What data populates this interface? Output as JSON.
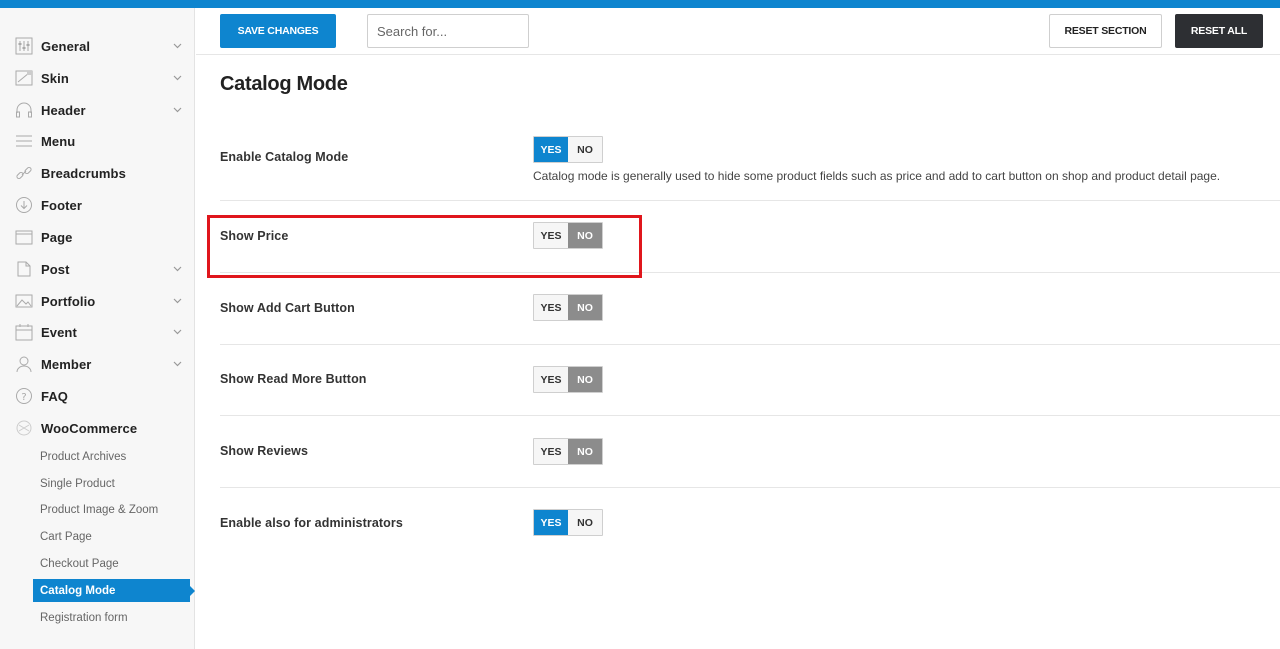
{
  "sidebar": {
    "items": [
      {
        "label": "General",
        "icon": "sliders-icon",
        "chevron": true
      },
      {
        "label": "Skin",
        "icon": "skin-icon",
        "chevron": true
      },
      {
        "label": "Header",
        "icon": "headphones-icon",
        "chevron": true
      },
      {
        "label": "Menu",
        "icon": "menu-icon",
        "chevron": false
      },
      {
        "label": "Breadcrumbs",
        "icon": "link-icon",
        "chevron": false
      },
      {
        "label": "Footer",
        "icon": "arrow-down-circle-icon",
        "chevron": false
      },
      {
        "label": "Page",
        "icon": "page-icon",
        "chevron": false
      },
      {
        "label": "Post",
        "icon": "post-icon",
        "chevron": true
      },
      {
        "label": "Portfolio",
        "icon": "image-icon",
        "chevron": true
      },
      {
        "label": "Event",
        "icon": "calendar-icon",
        "chevron": true
      },
      {
        "label": "Member",
        "icon": "user-icon",
        "chevron": true
      },
      {
        "label": "FAQ",
        "icon": "question-icon",
        "chevron": false
      },
      {
        "label": "WooCommerce",
        "icon": "woocommerce-icon",
        "chevron": false
      }
    ],
    "subitems": [
      {
        "label": "Product Archives",
        "active": false
      },
      {
        "label": "Single Product",
        "active": false
      },
      {
        "label": "Product Image & Zoom",
        "active": false
      },
      {
        "label": "Cart Page",
        "active": false
      },
      {
        "label": "Checkout Page",
        "active": false
      },
      {
        "label": "Catalog Mode",
        "active": true
      },
      {
        "label": "Registration form",
        "active": false
      }
    ]
  },
  "toolbar": {
    "save_label": "SAVE CHANGES",
    "search_placeholder": "Search for...",
    "search_value": "",
    "reset_section_label": "RESET SECTION",
    "reset_all_label": "RESET ALL"
  },
  "main": {
    "title": "Catalog Mode",
    "yes_label": "YES",
    "no_label": "NO",
    "options": [
      {
        "label": "Enable Catalog Mode",
        "value": "YES",
        "description": "Catalog mode is generally used to hide some product fields such as price and add to cart button on shop and product detail page."
      },
      {
        "label": "Show Price",
        "value": "NO"
      },
      {
        "label": "Show Add Cart Button",
        "value": "NO"
      },
      {
        "label": "Show Read More Button",
        "value": "NO"
      },
      {
        "label": "Show Reviews",
        "value": "NO"
      },
      {
        "label": "Enable also for administrators",
        "value": "YES"
      }
    ]
  },
  "colors": {
    "accent": "#0e85cf",
    "dark_button": "#2d2f33",
    "toggle_off_selected": "#8c8c8c",
    "highlight": "#e0161c"
  }
}
